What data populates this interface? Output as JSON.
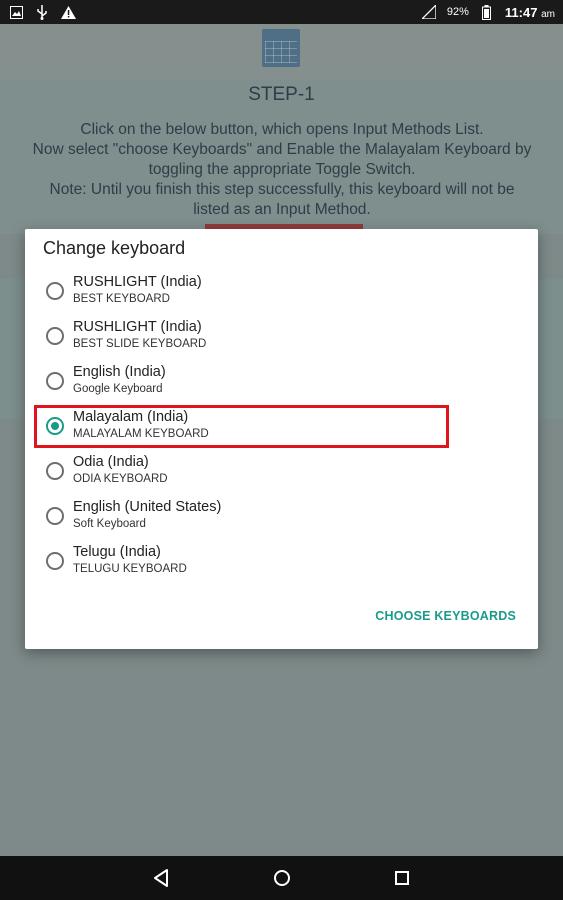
{
  "status_bar": {
    "left_icons": [
      "image-icon",
      "usb-icon",
      "warning-icon"
    ],
    "right_icons": [
      "signal-icon",
      "battery-icon"
    ],
    "battery_percent": "92%",
    "time": "11:47",
    "ampm": "am"
  },
  "app": {
    "step_title": "STEP-1",
    "instructions": [
      "Click on the below button, which opens Input Methods List.",
      "Now select \"choose Keyboards\" and Enable the Malayalam Keyboard by",
      "toggling the appropriate Toggle Switch.",
      "Note: Until you finish this step successfully, this keyboard will not be",
      "listed as an Input Method."
    ]
  },
  "dialog": {
    "title": "Change keyboard",
    "keyboards": [
      {
        "name": "RUSHLIGHT (India)",
        "subtitle": "BEST KEYBOARD",
        "selected": false
      },
      {
        "name": "RUSHLIGHT (India)",
        "subtitle": "BEST SLIDE KEYBOARD",
        "selected": false
      },
      {
        "name": "English (India)",
        "subtitle": "Google Keyboard",
        "selected": false
      },
      {
        "name": "Malayalam (India)",
        "subtitle": "MALAYALAM KEYBOARD",
        "selected": true
      },
      {
        "name": "Odia (India)",
        "subtitle": "ODIA KEYBOARD",
        "selected": false
      },
      {
        "name": "English (United States)",
        "subtitle": "Soft Keyboard",
        "selected": false
      },
      {
        "name": "Telugu (India)",
        "subtitle": "TELUGU KEYBOARD",
        "selected": false
      }
    ],
    "action_label": "CHOOSE KEYBOARDS"
  },
  "nav_bar": {
    "buttons": [
      "back-icon",
      "home-icon",
      "recents-icon"
    ]
  },
  "colors": {
    "accent": "#1a9a8a",
    "highlight": "#e0141c"
  }
}
